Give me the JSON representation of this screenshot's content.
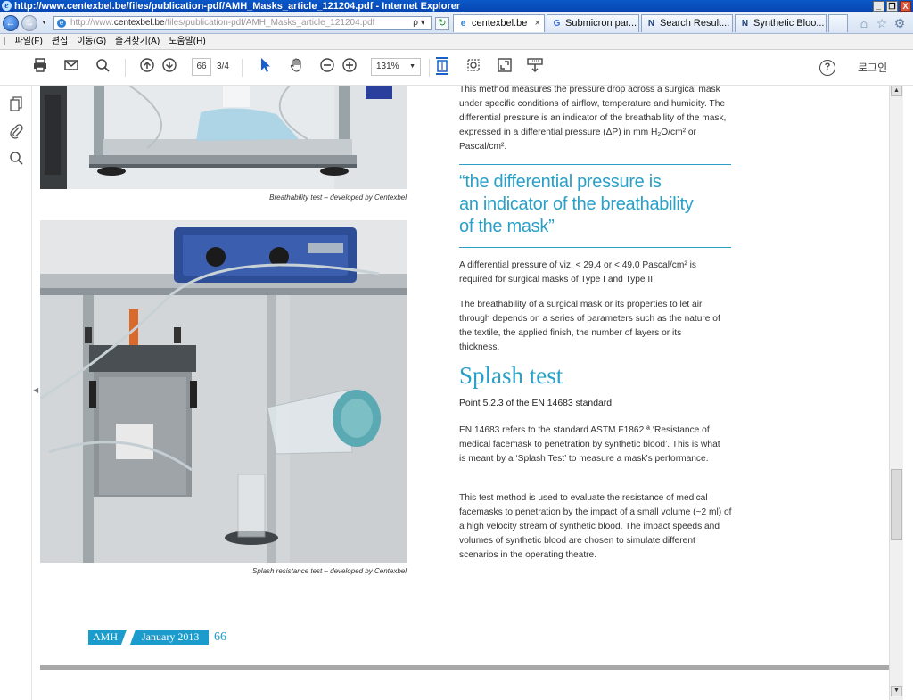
{
  "window": {
    "title": "http://www.centexbel.be/files/publication-pdf/AMH_Masks_article_121204.pdf - Internet Explorer",
    "min_label": "_",
    "restore_label": "❐",
    "close_label": "X"
  },
  "nav": {
    "back_icon": "←",
    "forward_icon": "→",
    "address_prefix": "http://www.",
    "address_domain": "centexbel.be",
    "address_suffix": "/files/publication-pdf/AMH_Masks_article_121204.pdf",
    "address_tools": "ρ ▾",
    "refresh_icon": "↻"
  },
  "tabs": [
    {
      "icon": "e",
      "label": "centexbel.be",
      "close": "×"
    },
    {
      "icon": "G",
      "label": "Submicron par..."
    },
    {
      "icon": "N",
      "label": "Search Result..."
    },
    {
      "icon": "N",
      "label": "Synthetic Bloo..."
    }
  ],
  "menu": [
    "파일(F)",
    "편집",
    "이동(G)",
    "즐겨찾기(A)",
    "도움말(H)"
  ],
  "pdf_toolbar": {
    "page_current": "66",
    "page_count": "3/4",
    "zoom": "131%",
    "help_icon": "?",
    "login": "로그인"
  },
  "figures": {
    "caption1": "Breathability test – developed by Centexbel",
    "caption2": "Splash resistance test – developed by Centexbel"
  },
  "article": {
    "intro": "This method measures the pressure drop across a surgical mask under specific conditions of airflow, temperature and humidity. The differential pressure is an indicator of the breathability of the mask, expressed in a differential pressure (ΔP) in mm H₂O/cm² or Pascal/cm².",
    "quote_line1": "“the differential pressure is",
    "quote_line2": "an indicator of the breathability",
    "quote_line3": "of the mask”",
    "para2": "A differential pressure of viz. < 29,4 or < 49,0 Pascal/cm² is required for surgical masks of Type I and Type II.",
    "para3": "The breathability of a surgical mask or its properties to let air through depends on a series of parameters such as the nature of the textile, the applied finish, the number of layers or its thickness.",
    "heading": "Splash test",
    "subheading": "Point 5.2.3 of the EN 14683 standard",
    "para4": "EN 14683 refers to the standard ASTM F1862 ª ‘Resistance of medical facemask to penetration by synthetic blood’. This is what is meant by a ‘Splash Test’ to measure a mask’s performance.",
    "para5": "This test method is used to evaluate the resistance of medical facemasks to penetration by the impact of a small volume (~2 ml) of a high velocity stream of synthetic blood. The impact speeds and volumes of synthetic blood are chosen to simulate different scenarios in the operating theatre."
  },
  "footer": {
    "brand": "AMH",
    "date": "January 2013",
    "page": "66"
  },
  "colors": {
    "accent": "#1b9ccc",
    "title_bar": "#0a58c8"
  }
}
